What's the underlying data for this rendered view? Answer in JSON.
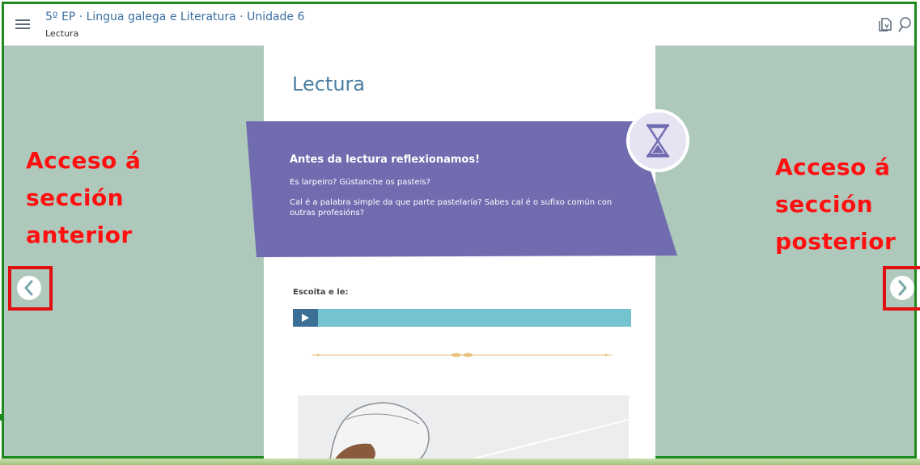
{
  "header": {
    "title": "5º EP · Lingua galega e Literatura · Unidade 6",
    "subtitle": "Lectura",
    "menu_icon": "hamburger-menu-icon",
    "actions": [
      "copy-pages-icon",
      "search-icon"
    ]
  },
  "page": {
    "title": "Lectura",
    "banner": {
      "heading": "Antes da lectura reflexionamos!",
      "paragraphs": [
        "Es larpeiro? Gústanche os pasteis?",
        "Cal é a palabra simple da que parte pastelaría? Sabes cal é o sufixo común con outras profesións?"
      ],
      "icon": "hourglass-icon",
      "color": "#716bb0"
    },
    "listen_label": "Escoita e le:",
    "audio_player": {
      "play_icon": "play-icon",
      "bar_color": "#74c3d0"
    }
  },
  "annotations": {
    "left": [
      "Acceso á",
      "sección",
      "anterior"
    ],
    "right": [
      "Acceso á",
      "sección",
      "posterior"
    ],
    "color": "#ff1010"
  },
  "nav": {
    "prev_icon": "chevron-left-icon",
    "next_icon": "chevron-right-icon"
  }
}
